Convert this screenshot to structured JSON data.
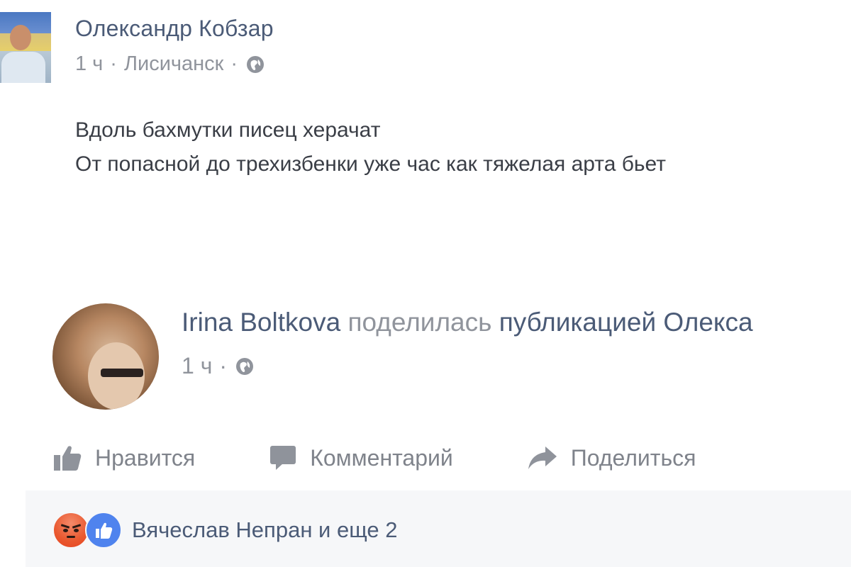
{
  "original_post": {
    "author": "Олександр Кобзар",
    "time": "1 ч",
    "separator": "·",
    "location": "Лисичанск",
    "privacy_icon": "globe-icon",
    "lines": [
      "Вдоль бахмутки писец херачат",
      "От попасной до трехизбенки уже час как тяжелая арта бьет"
    ]
  },
  "share": {
    "author": "Irina Boltkova",
    "verb": "поделилась",
    "object": "публикацией Олекса",
    "time": "1 ч",
    "separator": "·",
    "privacy_icon": "globe-icon"
  },
  "actions": {
    "like_label": "Нравится",
    "like_icon": "thumbs-up-icon",
    "comment_label": "Комментарий",
    "comment_icon": "speech-bubble-icon",
    "share_label": "Поделиться",
    "share_icon": "share-arrow-icon"
  },
  "reactions": {
    "icons": [
      "angry-reaction-icon",
      "like-reaction-icon"
    ],
    "summary": "Вячеслав Непран и еще 2"
  },
  "colors": {
    "name": "#4b5b77",
    "meta": "#90949c",
    "action": "#7f838b",
    "reaction_bg": "#f6f7f9",
    "like_blue": "#4f83ee",
    "angry_orange": "#e9582f"
  }
}
